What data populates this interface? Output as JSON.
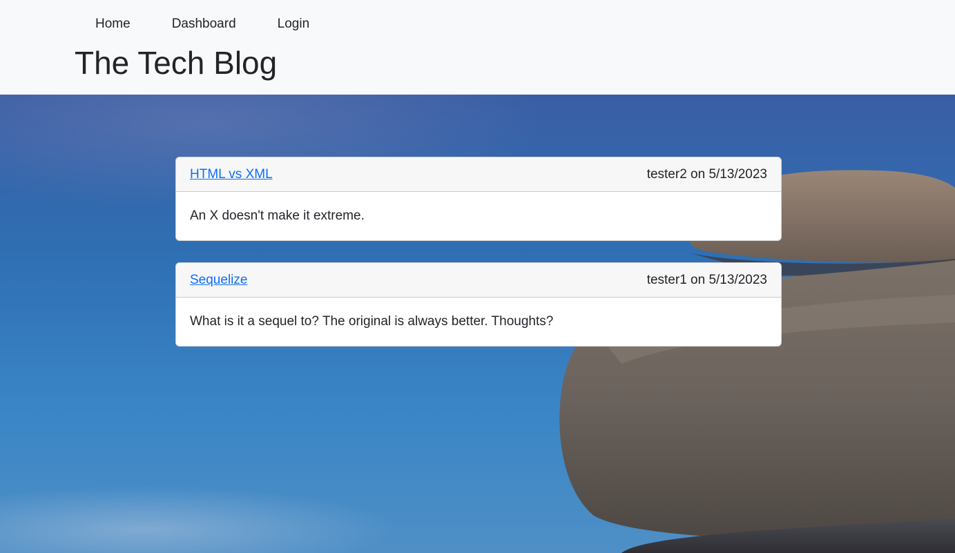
{
  "nav": {
    "items": [
      {
        "label": "Home"
      },
      {
        "label": "Dashboard"
      },
      {
        "label": "Login"
      }
    ]
  },
  "header": {
    "title": "The Tech Blog"
  },
  "posts": [
    {
      "title": "HTML vs XML",
      "meta": "tester2 on 5/13/2023",
      "body": "An X doesn't make it extreme."
    },
    {
      "title": "Sequelize",
      "meta": "tester1 on 5/13/2023",
      "body": "What is it a sequel to? The original is always better. Thoughts?"
    }
  ],
  "colors": {
    "header_bg": "#f8f9fa",
    "link": "#0d6efd",
    "sky": "#2f6fb3"
  }
}
